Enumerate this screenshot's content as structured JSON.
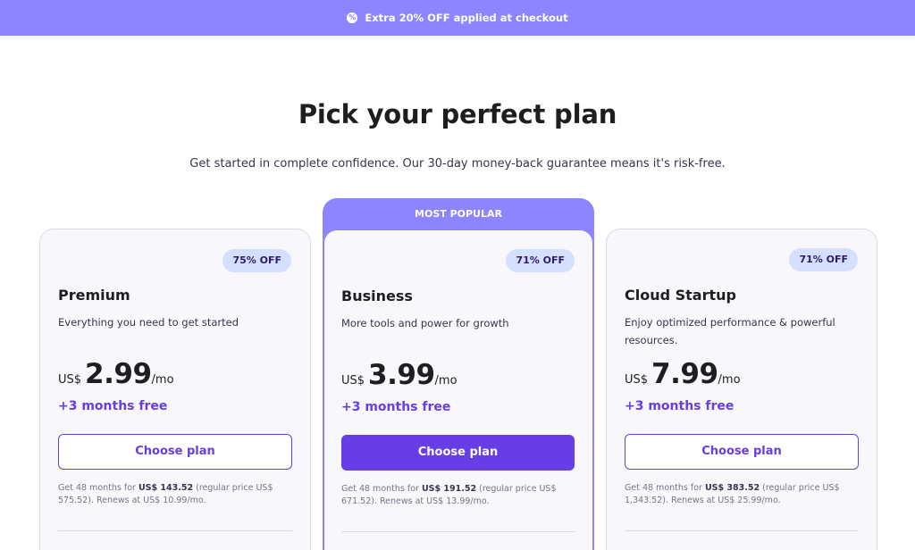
{
  "promo": {
    "icon": "percent-badge-icon",
    "text": "Extra 20% OFF applied at checkout"
  },
  "header": {
    "title": "Pick your perfect plan",
    "subtitle": "Get started in complete confidence. Our 30-day money-back guarantee means it's risk-free."
  },
  "colors": {
    "accent": "#673de6",
    "promo_bg": "#8c85ff",
    "badge_bg": "#d5dfff",
    "card_bg": "#f8f8fc"
  },
  "plans": [
    {
      "badge": "75% OFF",
      "name": "Premium",
      "description": "Everything you need to get started",
      "currency": "US$",
      "price": "2.99",
      "period": "/mo",
      "bonus": "+3 months free",
      "cta": "Choose plan",
      "fine_pre": "Get 48 months for ",
      "fine_total": "US$ 143.52",
      "fine_post": " (regular price US$ 575.52). Renews at US$ 10.99/mo."
    },
    {
      "ribbon": "MOST POPULAR",
      "badge": "71% OFF",
      "name": "Business",
      "description": "More tools and power for growth",
      "currency": "US$",
      "price": "3.99",
      "period": "/mo",
      "bonus": "+3 months free",
      "cta": "Choose plan",
      "fine_pre": "Get 48 months for ",
      "fine_total": "US$ 191.52",
      "fine_post": " (regular price US$ 671.52). Renews at US$ 13.99/mo."
    },
    {
      "badge": "71% OFF",
      "name": "Cloud Startup",
      "description": "Enjoy optimized performance & powerful resources.",
      "currency": "US$",
      "price": "7.99",
      "period": "/mo",
      "bonus": "+3 months free",
      "cta": "Choose plan",
      "fine_pre": "Get 48 months for ",
      "fine_total": "US$ 383.52",
      "fine_post": " (regular price US$ 1,343.52). Renews at US$ 25.99/mo."
    }
  ]
}
